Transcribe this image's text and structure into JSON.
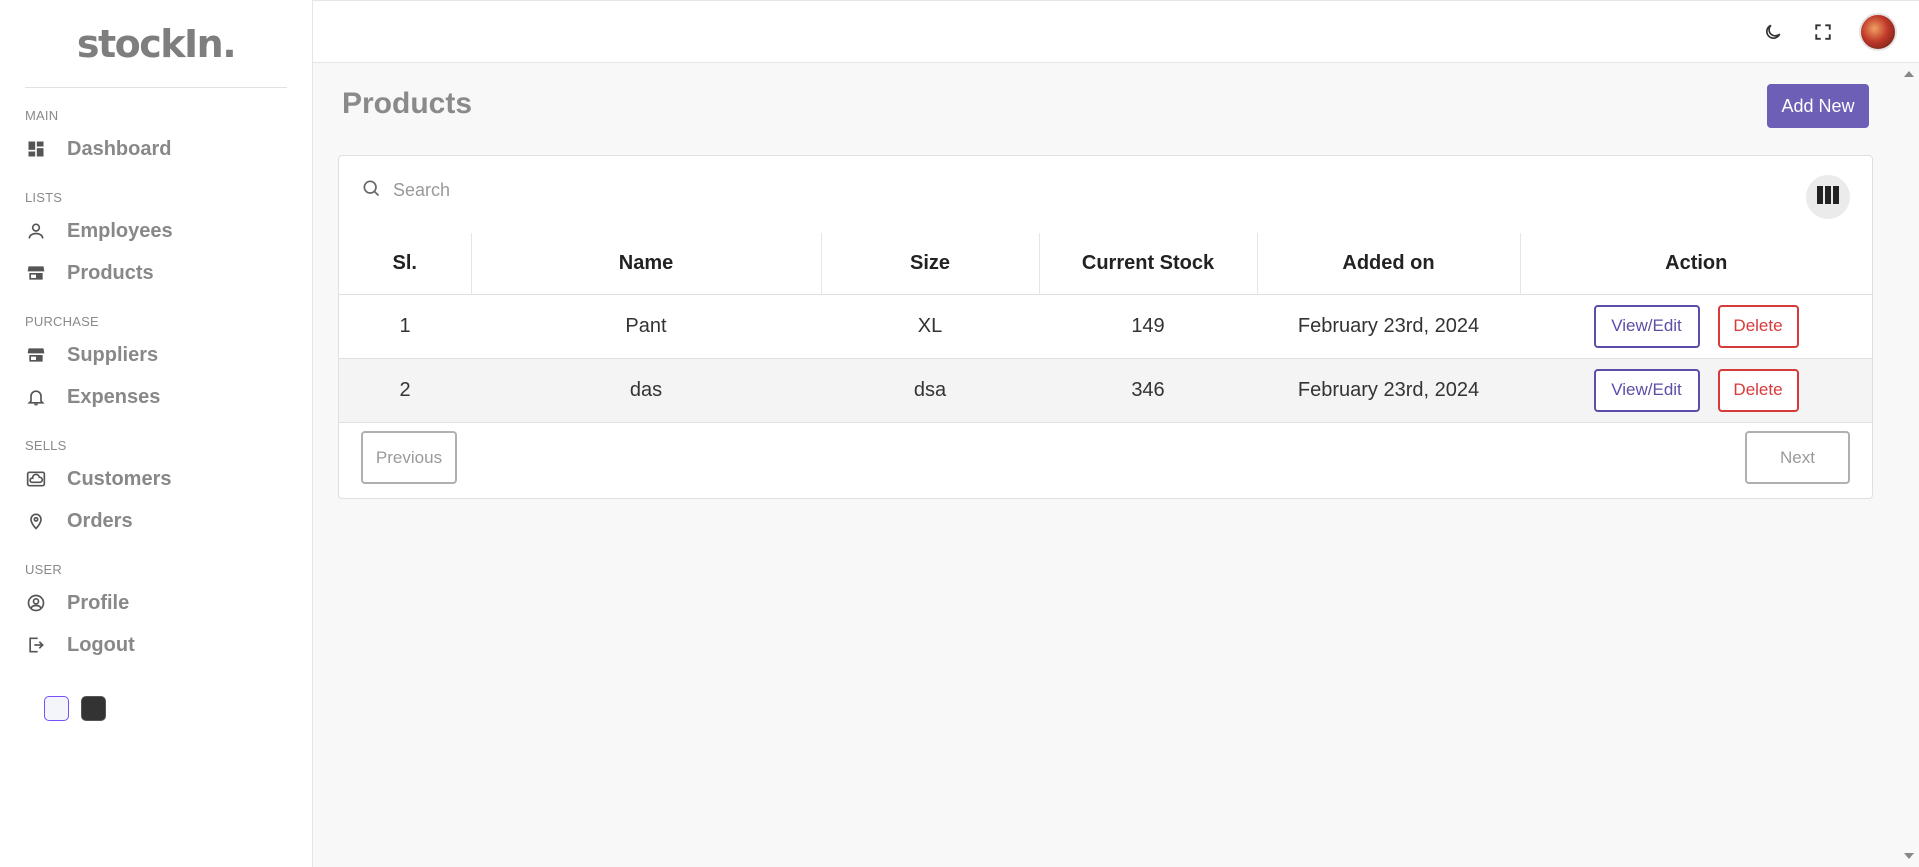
{
  "app": {
    "logo": "stockIn."
  },
  "sidebar": {
    "sections": [
      {
        "title": "MAIN",
        "items": [
          {
            "label": "Dashboard",
            "icon": "dashboard-icon"
          }
        ]
      },
      {
        "title": "LISTS",
        "items": [
          {
            "label": "Employees",
            "icon": "person-icon"
          },
          {
            "label": "Products",
            "icon": "store-icon"
          }
        ]
      },
      {
        "title": "PURCHASE",
        "items": [
          {
            "label": "Suppliers",
            "icon": "store-icon"
          },
          {
            "label": "Expenses",
            "icon": "bell-icon"
          }
        ]
      },
      {
        "title": "SELLS",
        "items": [
          {
            "label": "Customers",
            "icon": "cloud-box-icon"
          },
          {
            "label": "Orders",
            "icon": "location-icon"
          }
        ]
      },
      {
        "title": "USER",
        "items": [
          {
            "label": "Profile",
            "icon": "user-circle-icon"
          },
          {
            "label": "Logout",
            "icon": "logout-icon"
          }
        ]
      }
    ],
    "themes": [
      "light",
      "dark"
    ]
  },
  "header": {
    "icons": [
      "moon-icon",
      "fullscreen-icon",
      "avatar"
    ]
  },
  "main": {
    "title": "Products",
    "add_label": "Add New",
    "search": {
      "placeholder": "Search"
    },
    "table": {
      "columns": [
        "Sl.",
        "Name",
        "Size",
        "Current Stock",
        "Added on",
        "Action"
      ],
      "rows": [
        {
          "sl": "1",
          "name": "Pant",
          "size": "XL",
          "stock": "149",
          "added": "February 23rd, 2024"
        },
        {
          "sl": "2",
          "name": "das",
          "size": "dsa",
          "stock": "346",
          "added": "February 23rd, 2024"
        }
      ],
      "edit_label": "View/Edit",
      "delete_label": "Delete"
    },
    "pagination": {
      "prev": "Previous",
      "next": "Next"
    }
  },
  "colors": {
    "accent": "#6d5fb5",
    "danger": "#d73a3a",
    "icon": "#7b5fc6"
  }
}
